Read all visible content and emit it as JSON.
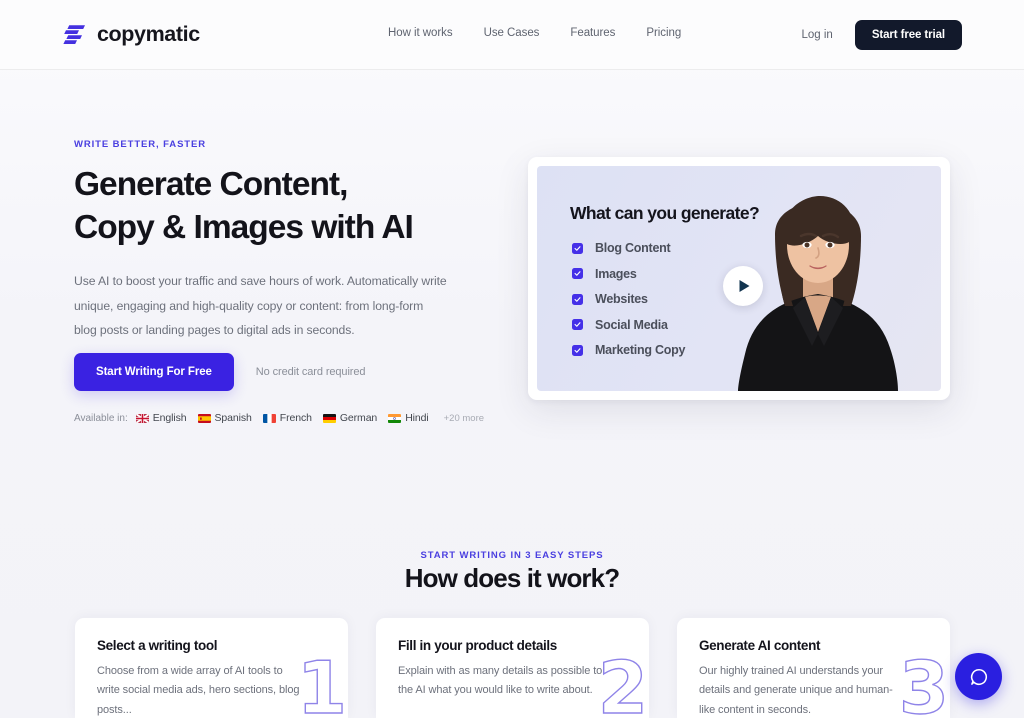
{
  "header": {
    "logo_text": "copymatic",
    "nav": [
      {
        "label": "How it works"
      },
      {
        "label": "Use Cases"
      },
      {
        "label": "Features"
      },
      {
        "label": "Pricing"
      }
    ],
    "login_label": "Log in",
    "trial_label": "Start free trial"
  },
  "hero": {
    "eyebrow": "WRITE BETTER, FASTER",
    "title": "Generate Content,\nCopy & Images with AI",
    "subtitle": "Use AI to boost your traffic and save hours of work. Automatically write unique, engaging and high-quality copy or content: from long-form blog posts or landing pages to digital ads in seconds.",
    "cta_label": "Start Writing For Free",
    "cta_note": "No credit card required",
    "languages_label": "Available in:",
    "languages": [
      {
        "name": "English",
        "flag": "flag-uk"
      },
      {
        "name": "Spanish",
        "flag": "flag-spain"
      },
      {
        "name": "French",
        "flag": "flag-france"
      },
      {
        "name": "German",
        "flag": "flag-germany"
      },
      {
        "name": "Hindi",
        "flag": "flag-india"
      }
    ],
    "languages_more": "+20 more"
  },
  "video_card": {
    "title": "What can you generate?",
    "items": [
      {
        "label": "Blog Content"
      },
      {
        "label": "Images"
      },
      {
        "label": "Websites"
      },
      {
        "label": "Social Media"
      },
      {
        "label": "Marketing Copy"
      }
    ]
  },
  "how_it_works": {
    "eyebrow": "START WRITING IN 3 EASY STEPS",
    "title": "How does it work?",
    "steps": [
      {
        "number": "1",
        "title": "Select a writing tool",
        "desc": "Choose from a wide array of AI tools to write social media ads, hero sections, blog posts..."
      },
      {
        "number": "2",
        "title": "Fill in your product details",
        "desc": "Explain with as many details as possible to the AI what you would like to write about."
      },
      {
        "number": "3",
        "title": "Generate AI content",
        "desc": "Our highly trained AI understands your details and generate unique and human-like content in seconds."
      }
    ]
  },
  "colors": {
    "accent_purple": "#4a3fe0",
    "primary_button": "#3a22e2",
    "dark_button": "#12192b",
    "checkbox": "#4530e8",
    "chat_widget": "#2a1fe0",
    "numeral_outline": "#8f84e8"
  }
}
